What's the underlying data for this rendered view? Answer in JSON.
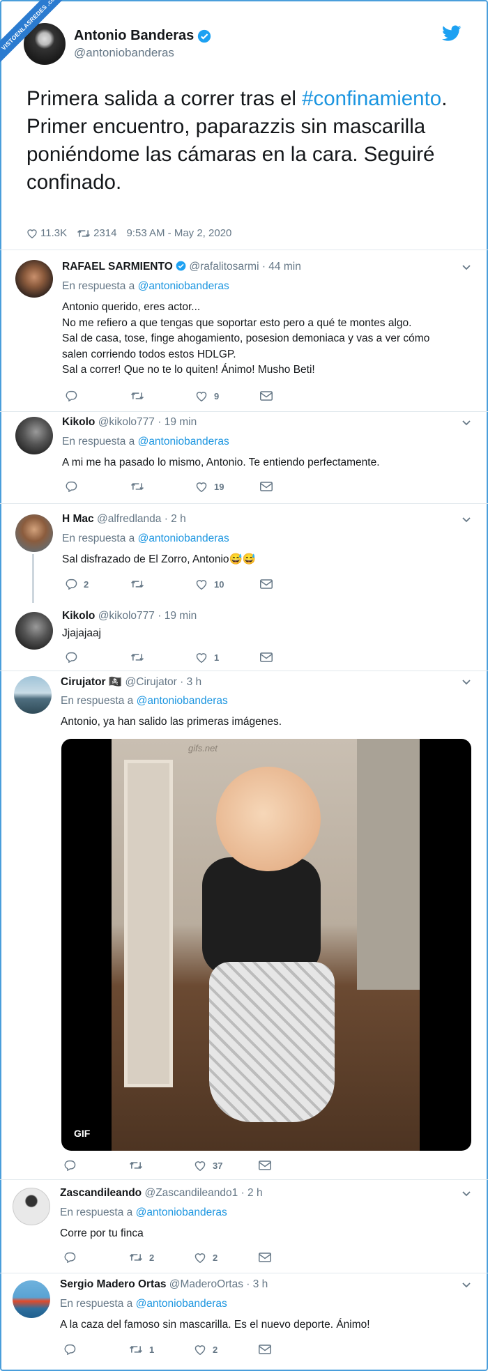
{
  "badge": "VISTOENLASREDES .com",
  "main": {
    "name": "Antonio Banderas",
    "handle": "@antoniobanderas",
    "text_before": "Primera salida a correr tras el",
    "hashtag": "#confinamiento",
    "text_after": ". Primer encuentro, paparazzis sin mascarilla poniéndome las cámaras en la cara. Seguiré confinado.",
    "likes": "11.3K",
    "retweets": "2314",
    "timestamp": "9:53 AM - May 2, 2020"
  },
  "reply_prefix": "En respuesta a",
  "reply_target": "@antoniobanderas",
  "replies": [
    {
      "name": "RAFAEL SARMIENTO",
      "handle": "@rafalitosarmi",
      "time": "· 44 min",
      "lines": [
        "Antonio querido, eres actor...",
        "No me refiero a que tengas que soportar esto pero a qué te montes algo.",
        "Sal de casa, tose, finge ahogamiento, posesion demoniaca y vas a ver cómo",
        "salen corriendo todos estos HDLGP.",
        "Sal a correr! Que no te lo quiten! Ánimo! Musho Beti!"
      ],
      "replies": "",
      "retweets": "",
      "likes": "9"
    },
    {
      "name": "Kikolo",
      "handle": "@kikolo777",
      "time": "· 19 min",
      "lines": [
        "A mi me ha pasado lo mismo, Antonio. Te entiendo perfectamente."
      ],
      "replies": "",
      "retweets": "",
      "likes": "19"
    },
    {
      "name": "H Mac",
      "handle": "@alfredlanda",
      "time": "· 2 h",
      "lines": [
        "Sal disfrazado de El Zorro, Antonio😅😅"
      ],
      "replies": "2",
      "retweets": "",
      "likes": "10"
    },
    {
      "name": "Kikolo",
      "handle": "@kikolo777",
      "time": "· 19 min",
      "lines": [
        "Jjajajaaj"
      ],
      "replies": "",
      "retweets": "",
      "likes": "1"
    },
    {
      "name": "Cirujator 🏴‍☠️",
      "handle": "@Cirujator",
      "time": "· 3 h",
      "lines": [
        "Antonio, ya han salido las primeras imágenes."
      ],
      "media": {
        "badge": "GIF",
        "watermark": "gifs.net"
      },
      "replies": "",
      "retweets": "",
      "likes": "37"
    },
    {
      "name": "Zascandileando",
      "handle": "@Zascandileando1",
      "time": "· 2 h",
      "lines": [
        "Corre por tu finca"
      ],
      "replies": "",
      "retweets": "2",
      "likes": "2"
    },
    {
      "name": "Sergio Madero Ortas",
      "handle": "@MaderoOrtas",
      "time": "· 3 h",
      "lines": [
        "A la caza del famoso sin mascarilla. Es el nuevo deporte. Ánimo!"
      ],
      "replies": "",
      "retweets": "1",
      "likes": "2"
    }
  ],
  "colors": {
    "accent": "#1b95e0",
    "muted": "#657786",
    "text": "#14171a",
    "frame": "#4a9edb"
  }
}
